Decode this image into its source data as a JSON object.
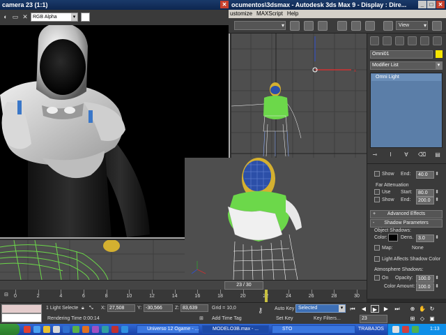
{
  "frame_window": {
    "title": "camera 23 (1:1)",
    "channel": "RGB Alpha"
  },
  "max_window": {
    "title": "ocumentos\\3dsmax  -  Autodesk 3ds Max 9  -  Display : Dire...",
    "menu": [
      "ustomize",
      "MAXScript",
      "Help"
    ],
    "view_dropdown": "View"
  },
  "command_panel": {
    "object_name": "Omni01",
    "object_color": "#f5e400",
    "modifier_list": "Modifier List",
    "stack_item": "Omni Light",
    "show_label": "Show",
    "end_label": "End:",
    "near_end": "40.0",
    "far_atten_label": "Far Attenuation",
    "use_label": "Use",
    "start_label": "Start:",
    "far_start": "80.0",
    "far_show_label": "Show",
    "far_end_label": "End:",
    "far_end": "200.0",
    "advanced_effects": "Advanced Effects",
    "shadow_params": "Shadow Parameters",
    "object_shadows": "Object Shadows:",
    "color_label": "Color:",
    "dens_label": "Dens.",
    "dens": "3.0",
    "map_label": "Map:",
    "map_value": "None",
    "light_affects": "Light Affects Shadow Color",
    "atmosphere_shadows": "Atmosphere Shadows:",
    "on_label": "On",
    "opacity_label": "Opacity:",
    "opacity": "100.0",
    "color_amount_label": "Color Amount:",
    "color_amount": "100.0"
  },
  "timeline": {
    "slider": "23 / 30",
    "ticks": [
      "0",
      "2",
      "4",
      "6",
      "8",
      "10",
      "12",
      "14",
      "16",
      "18",
      "20",
      "22",
      "24",
      "26",
      "28",
      "30"
    ]
  },
  "status": {
    "selection": "1 Light Selecte",
    "x_label": "X:",
    "x": "27,508",
    "y_label": "Y:",
    "y": "-30,566",
    "z_label": "Z:",
    "z": "83,639",
    "grid": "Grid = 10,0",
    "rendering_time": "Rendering Time  0:00:14",
    "add_time_tag": "Add Time Tag",
    "auto_key": "Auto Key",
    "key_mode": "Selected",
    "set_key": "Set Key",
    "key_filters": "Key Filters...",
    "current_frame": "23"
  },
  "taskbar": {
    "tasks": [
      "Universo 12 Ogame - ...",
      "MODELO3B.max - ...",
      "STO"
    ],
    "tray_text": "TRABAJOS",
    "clock": "1:13"
  }
}
